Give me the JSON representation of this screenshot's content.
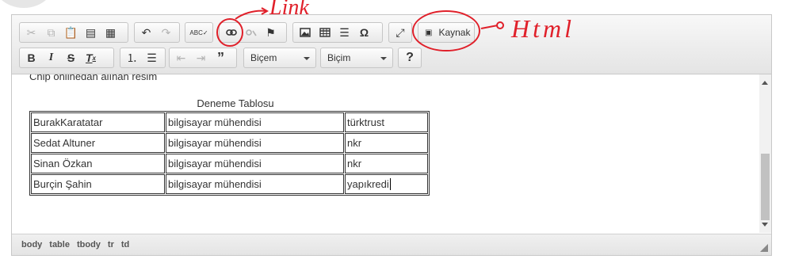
{
  "toolbar": {
    "row1": {
      "clipboard": [
        "cut-icon",
        "copy-icon",
        "paste-icon",
        "paste-text-icon",
        "paste-word-icon"
      ],
      "history": [
        "undo-icon",
        "redo-icon"
      ],
      "spell_icon": "ABC✓",
      "source_label": "Kaynak"
    },
    "row2": {
      "style_label": "Biçem",
      "format_label": "Biçim",
      "help_label": "?"
    }
  },
  "content": {
    "cut_text": "Chip onlinedan alınan resim",
    "caption": "Deneme Tablosu",
    "rows": [
      [
        "BurakKaratatar",
        "bilgisayar mühendisi",
        "türktrust"
      ],
      [
        "Sedat Altuner",
        "bilgisayar mühendisi",
        "nkr"
      ],
      [
        "Sinan Özkan",
        "bilgisayar mühendisi",
        "nkr"
      ],
      [
        "Burçin Şahin",
        "bilgisayar mühendisi",
        "yapıkredi"
      ]
    ]
  },
  "statusbar": {
    "path": [
      "body",
      "table",
      "tbody",
      "tr",
      "td"
    ]
  },
  "annotations": {
    "link": "Link",
    "html": "Html"
  },
  "colors": {
    "annotation": "#e0202a",
    "toolbar_bg": "#e4e4e4"
  }
}
